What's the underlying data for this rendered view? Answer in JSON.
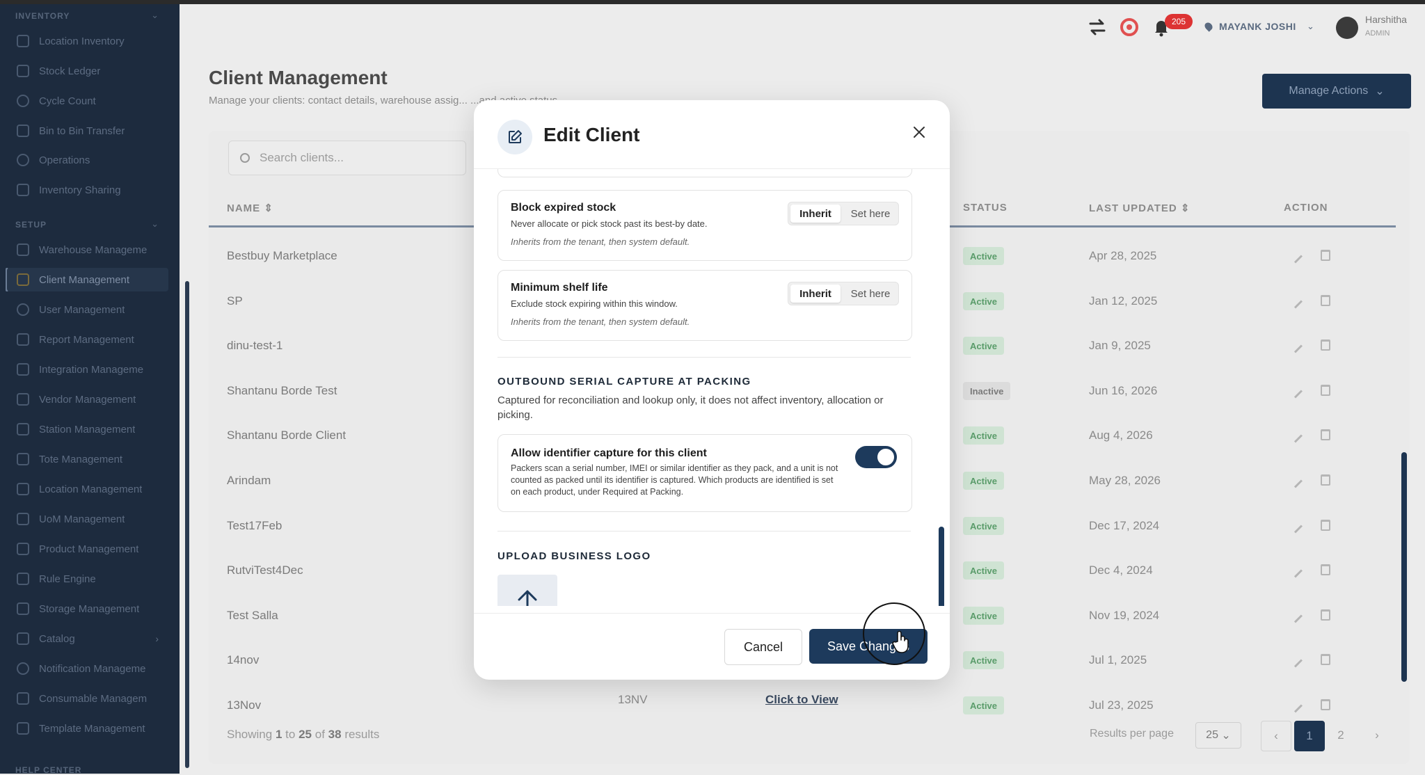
{
  "sidebar": {
    "sections": [
      {
        "label": "INVENTORY"
      },
      {
        "label": "SETUP"
      },
      {
        "label": "HELP CENTER"
      }
    ],
    "items": [
      {
        "label": "Location Inventory"
      },
      {
        "label": "Stock Ledger"
      },
      {
        "label": "Cycle Count"
      },
      {
        "label": "Bin to Bin Transfer"
      },
      {
        "label": "Operations"
      },
      {
        "label": "Inventory Sharing"
      },
      {
        "label": "Warehouse Manageme"
      },
      {
        "label": "Client Management"
      },
      {
        "label": "User Management"
      },
      {
        "label": "Report Management"
      },
      {
        "label": "Integration Manageme"
      },
      {
        "label": "Vendor Management"
      },
      {
        "label": "Station Management"
      },
      {
        "label": "Tote Management"
      },
      {
        "label": "Location Management"
      },
      {
        "label": "UoM Management"
      },
      {
        "label": "Product Management"
      },
      {
        "label": "Rule Engine"
      },
      {
        "label": "Storage Management"
      },
      {
        "label": "Catalog"
      },
      {
        "label": "Notification Manageme"
      },
      {
        "label": "Consumable Managem"
      },
      {
        "label": "Template Management"
      }
    ]
  },
  "header": {
    "notification_count": "205",
    "location": "MAYANK JOSHI",
    "user_name": "Harshitha",
    "user_role": "ADMIN"
  },
  "page": {
    "title": "Client Management",
    "subtitle": "Manage your clients: contact details, warehouse assig... ...and active status",
    "manage_actions": "Manage Actions",
    "search_placeholder": "Search clients..."
  },
  "table": {
    "headers": {
      "name": "NAME",
      "status": "STATUS",
      "last_updated": "LAST UPDATED",
      "action": "ACTION"
    },
    "rows": [
      {
        "name": "Bestbuy Marketplace",
        "status": "Active",
        "date": "Apr 28, 2025"
      },
      {
        "name": "SP",
        "status": "Active",
        "date": "Jan 12, 2025"
      },
      {
        "name": "dinu-test-1",
        "status": "Active",
        "date": "Jan 9, 2025"
      },
      {
        "name": "Shantanu Borde Test",
        "status": "Inactive",
        "date": "Jun 16, 2026"
      },
      {
        "name": "Shantanu Borde Client",
        "status": "Active",
        "date": "Aug 4, 2026"
      },
      {
        "name": "Arindam",
        "status": "Active",
        "date": "May 28, 2026"
      },
      {
        "name": "Test17Feb",
        "status": "Active",
        "date": "Dec 17, 2024"
      },
      {
        "name": "RutviTest4Dec",
        "status": "Active",
        "date": "Dec 4, 2024"
      },
      {
        "name": "Test Salla",
        "status": "Active",
        "date": "Nov 19, 2024"
      },
      {
        "name": "14nov",
        "status": "Active",
        "date": "Jul 1, 2025"
      },
      {
        "name": "13Nov",
        "status": "Active",
        "date": "Jul 23, 2025"
      }
    ],
    "row13_code": "13NV",
    "row13_link": "Click to View"
  },
  "footer": {
    "showing_prefix": "Showing",
    "from": "1",
    "to_word": "to",
    "to": "25",
    "of_word": "of",
    "total": "38",
    "suffix": "results",
    "results_per_page_label": "Results per page",
    "results_per_page": "25",
    "pages": [
      "1",
      "2"
    ]
  },
  "modal": {
    "title": "Edit Client",
    "block_expired": {
      "title": "Block expired stock",
      "desc": "Never allocate or pick stock past its best-by date.",
      "note": "Inherits from the tenant, then system default.",
      "opt_inherit": "Inherit",
      "opt_set": "Set here"
    },
    "min_shelf": {
      "title": "Minimum shelf life",
      "desc": "Exclude stock expiring within this window.",
      "note": "Inherits from the tenant, then system default.",
      "opt_inherit": "Inherit",
      "opt_set": "Set here"
    },
    "serial": {
      "heading": "OUTBOUND SERIAL CAPTURE AT PACKING",
      "desc": "Captured for reconciliation and lookup only, it does not affect inventory, allocation or picking.",
      "toggle_title": "Allow identifier capture for this client",
      "toggle_desc": "Packers scan a serial number, IMEI or similar identifier as they pack, and a unit is not counted as packed until its identifier is captured. Which products are identified is set on each product, under Required at Packing.",
      "toggle_on": true
    },
    "logo_heading": "UPLOAD BUSINESS LOGO",
    "cancel": "Cancel",
    "save": "Save Changes"
  },
  "colors": {
    "sidebar_bg": "#1d2b3e",
    "primary": "#1d3a5c",
    "active_green": "#5a9c6a",
    "badge_red": "#d33"
  }
}
